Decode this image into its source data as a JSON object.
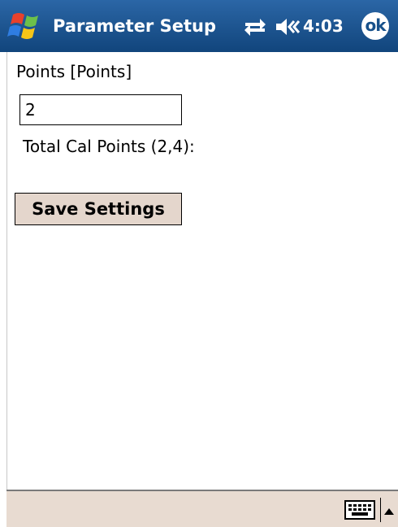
{
  "titlebar": {
    "title": "Parameter Setup",
    "time": "4:03",
    "ok_label": "ok",
    "background_color": "#17508a"
  },
  "icons": {
    "start": "windows-flag-icon",
    "connectivity": "connectivity-arrows-icon",
    "volume": "speaker-volume-icon",
    "keyboard": "keyboard-icon",
    "sip_arrow": "triangle-up-icon"
  },
  "form": {
    "points_label": "Points [Points]",
    "points_value": "2",
    "total_cal_label": "Total Cal Points (2,4):",
    "save_label": "Save Settings",
    "button_color": "#e4d6cc"
  },
  "menubar": {
    "background_color": "#e8dbd1"
  }
}
